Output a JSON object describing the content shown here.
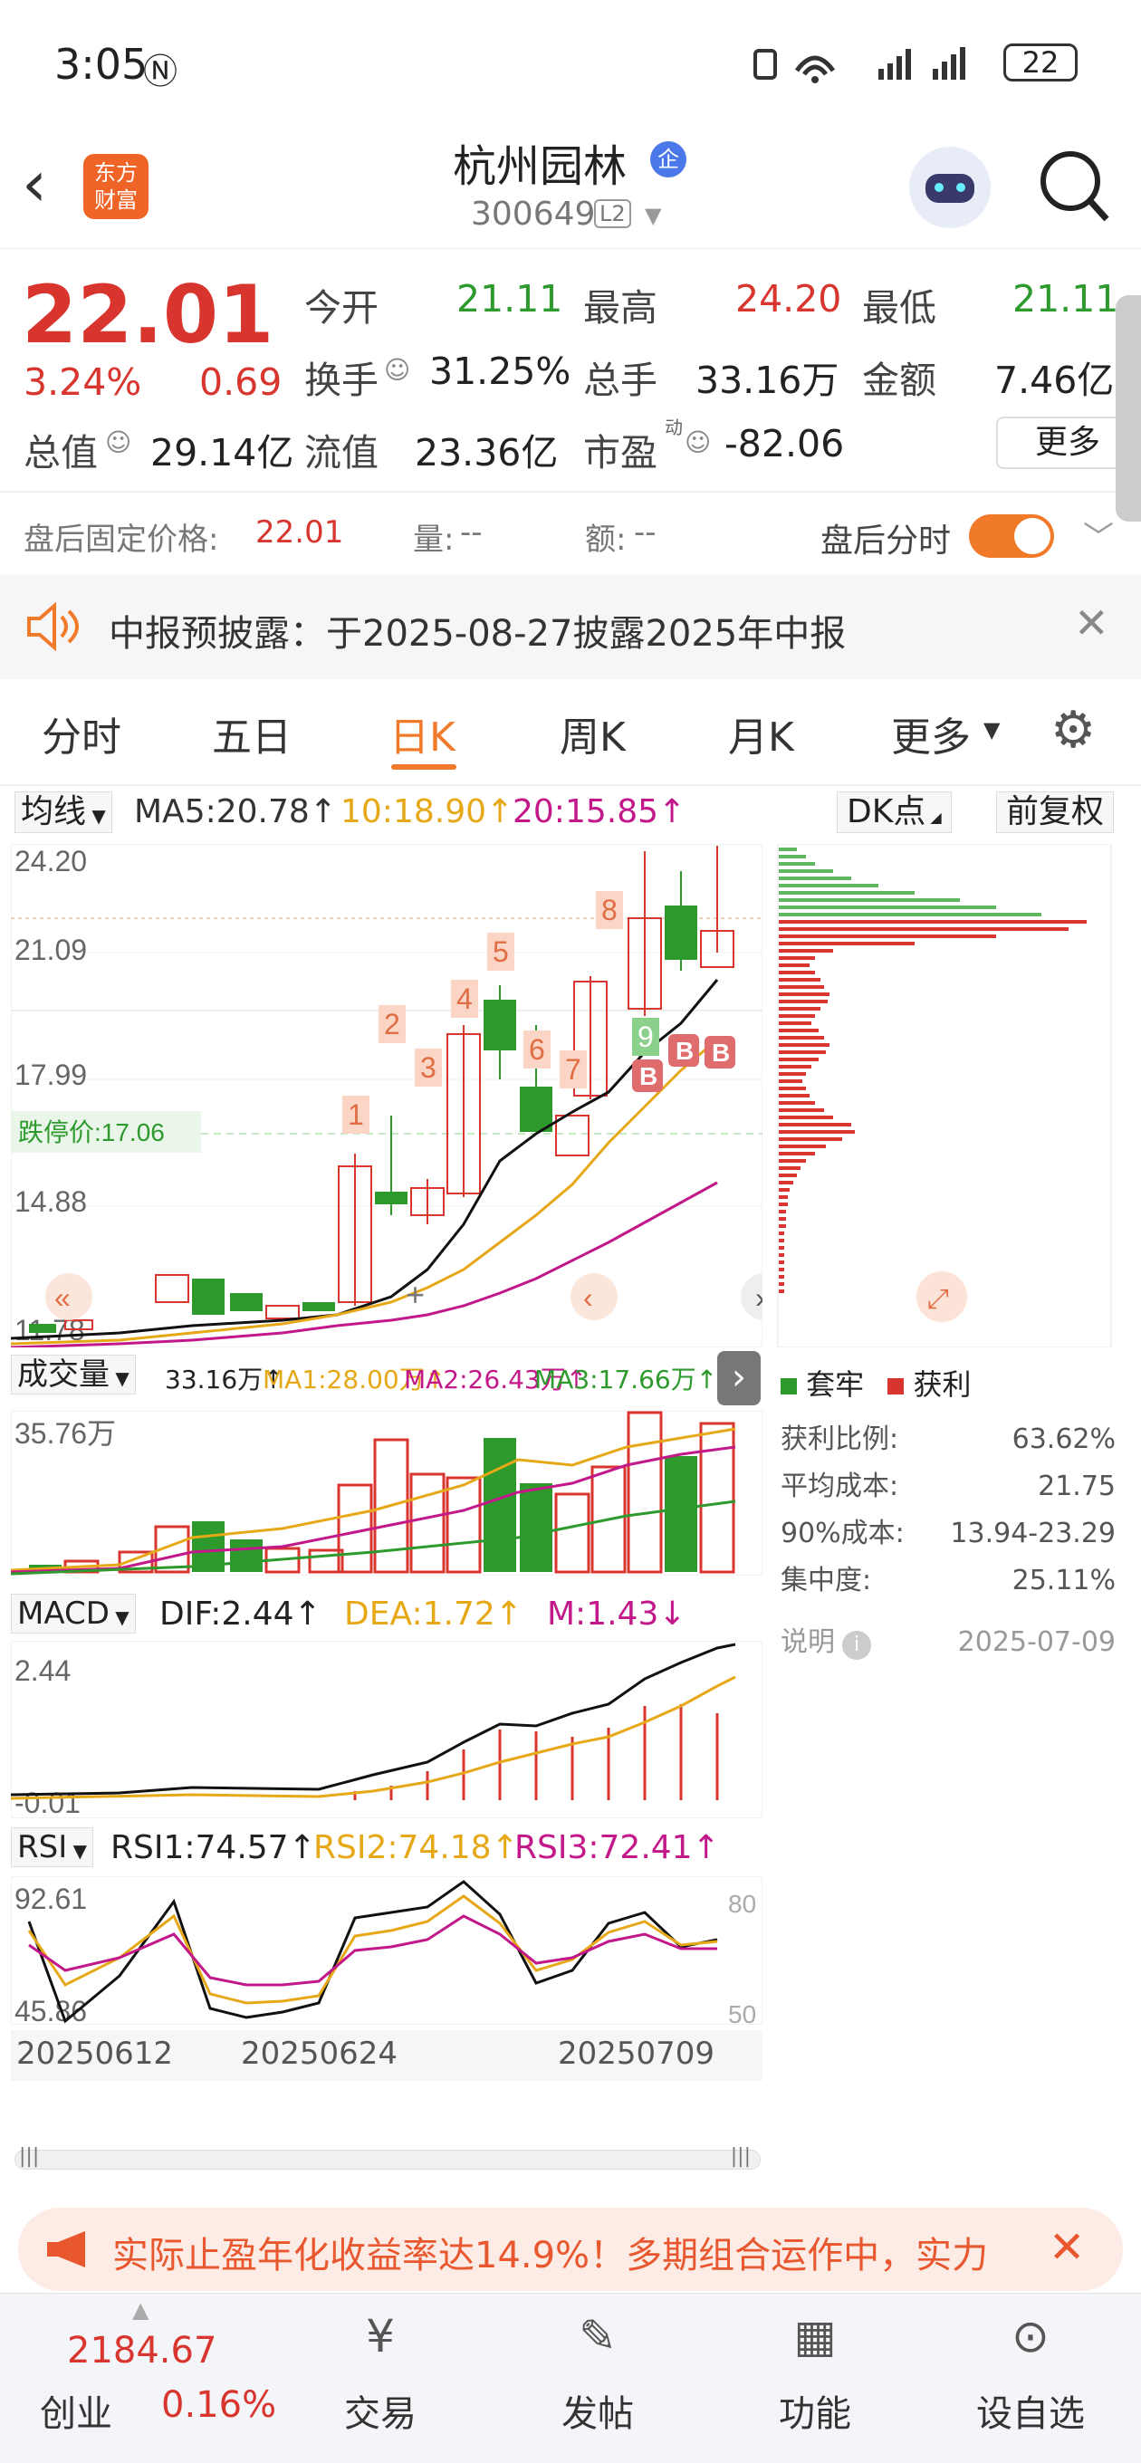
{
  "status": {
    "time": "3:05",
    "battery": "22"
  },
  "header": {
    "stock_name": "杭州园林",
    "stock_badge": "企",
    "stock_code": "300649",
    "level": "L2",
    "logo_line1": "东方",
    "logo_line2": "财富"
  },
  "quote": {
    "price": "22.01",
    "change_pct": "3.24%",
    "change": "0.69",
    "open_label": "今开",
    "open": "21.11",
    "high_label": "最高",
    "high": "24.20",
    "low_label": "最低",
    "low": "21.11",
    "turnover_label": "换手",
    "turnover": "31.25%",
    "volume_label": "总手",
    "volume": "33.16万",
    "amount_label": "金额",
    "amount": "7.46亿",
    "mktcap_label": "总值",
    "mktcap": "29.14亿",
    "float_label": "流值",
    "float_cap": "23.36亿",
    "pe_label": "市盈",
    "pe_sup": "动",
    "pe": "-82.06",
    "more": "更多",
    "after_label": "盘后固定价格:",
    "after_price": "22.01",
    "after_vol_label": "量:",
    "after_vol": "--",
    "after_amt_label": "额:",
    "after_amt": "--",
    "after_time_label": "盘后分时"
  },
  "notice": {
    "text": "中报预披露：于2025-08-27披露2025年中报"
  },
  "tabs": [
    "分时",
    "五日",
    "日K",
    "周K",
    "月K",
    "更多"
  ],
  "ma": {
    "selector": "均线",
    "ma5": "MA5:20.78↑",
    "ma10": "10:18.90↑",
    "ma20": "20:15.85↑",
    "dk": "DK点",
    "fq": "前复权"
  },
  "kline": {
    "price_labels": [
      "24.20",
      "21.09",
      "17.99",
      "14.88",
      "11.78"
    ],
    "limit_down": "跌停价:17.06",
    "markers": [
      "1",
      "2",
      "3",
      "4",
      "5",
      "6",
      "7",
      "8",
      "9"
    ],
    "buy_markers": [
      "B",
      "B",
      "B"
    ]
  },
  "profile": {
    "legend_trap": "套牢",
    "legend_profit": "获利",
    "profit_ratio_label": "获利比例:",
    "profit_ratio": "63.62%",
    "avg_cost_label": "平均成本:",
    "avg_cost": "21.75",
    "cost90_label": "90%成本:",
    "cost90": "13.94-23.29",
    "concentration_label": "集中度:",
    "concentration": "25.11%",
    "desc_label": "说明",
    "date": "2025-07-09"
  },
  "volume_ind": {
    "selector": "成交量",
    "vol": "33.16万↑",
    "ma1": "MA1:28.00万↑",
    "ma2": "MA2:26.43万↑",
    "ma3": "MA3:17.66万↑",
    "max": "35.76万"
  },
  "macd": {
    "selector": "MACD",
    "dif": "DIF:2.44↑",
    "dea": "DEA:1.72↑",
    "m": "M:1.43↓",
    "max": "2.44",
    "min": "-0.01"
  },
  "rsi": {
    "selector": "RSI",
    "rsi1": "RSI1:74.57↑",
    "rsi2": "RSI2:74.18↑",
    "rsi3": "RSI3:72.41↑",
    "max": "92.61",
    "min": "45.86",
    "r80": "80",
    "r50": "50"
  },
  "dates": [
    "20250612",
    "20250624",
    "20250709"
  ],
  "ad": {
    "text": "实际止盈年化收益率达14.9%！多期组合运作中，实力"
  },
  "bottom": {
    "index_value": "2184.67",
    "index_name": "创业",
    "index_change": "0.16%",
    "trade": "交易",
    "post": "发帖",
    "func": "功能",
    "watch": "设自选"
  },
  "colors": {
    "red": "#d8352f",
    "green": "#2e9a2e",
    "orange": "#f07a2a"
  }
}
